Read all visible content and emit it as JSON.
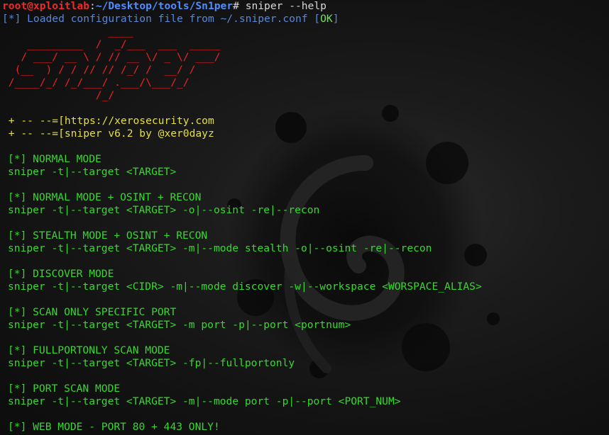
{
  "prompt": {
    "user_host": "root@xploitlab",
    "separator": ":",
    "path": "~/Desktop/tools/Sn1per",
    "symbol": "#",
    "command": " sniper --help"
  },
  "config_line": {
    "prefix": "[*] Loaded configuration file from ~/.sniper.conf [",
    "status": "OK",
    "suffix": "]"
  },
  "ascii_logo": [
    "                 ____",
    "    _________  /  _/___  ___  _____",
    "   / ___/ __ \\ / // __ \\/ _ \\/ ___/",
    "  (__  ) / / // // /_/ /  __/ /",
    " /____/_/ /_/___/ .___/\\___/_/",
    "               /_/"
  ],
  "info_lines": [
    " + -- --=[https://xerosecurity.com",
    " + -- --=[sniper v6.2 by @xer0dayz"
  ],
  "modes": [
    {
      "title": "[*] NORMAL MODE",
      "usage": "sniper -t|--target <TARGET>"
    },
    {
      "title": "[*] NORMAL MODE + OSINT + RECON",
      "usage": "sniper -t|--target <TARGET> -o|--osint -re|--recon"
    },
    {
      "title": "[*] STEALTH MODE + OSINT + RECON",
      "usage": "sniper -t|--target <TARGET> -m|--mode stealth -o|--osint -re|--recon"
    },
    {
      "title": "[*] DISCOVER MODE",
      "usage": "sniper -t|--target <CIDR> -m|--mode discover -w|--workspace <WORSPACE_ALIAS>"
    },
    {
      "title": "[*] SCAN ONLY SPECIFIC PORT",
      "usage": "sniper -t|--target <TARGET> -m port -p|--port <portnum>"
    },
    {
      "title": "[*] FULLPORTONLY SCAN MODE",
      "usage": "sniper -t|--target <TARGET> -fp|--fullportonly"
    },
    {
      "title": "[*] PORT SCAN MODE",
      "usage": "sniper -t|--target <TARGET> -m|--mode port -p|--port <PORT_NUM>"
    },
    {
      "title": "[*] WEB MODE - PORT 80 + 443 ONLY!",
      "usage": ""
    }
  ],
  "colors": {
    "background": "#101010",
    "prompt_user": "#ee2a2a",
    "prompt_path": "#4f8cff",
    "ascii_logo": "#ee2222",
    "config_text": "#5a86d6",
    "ok": "#6ee05a",
    "info": "#e6df3f",
    "modes": "#36d92e"
  }
}
